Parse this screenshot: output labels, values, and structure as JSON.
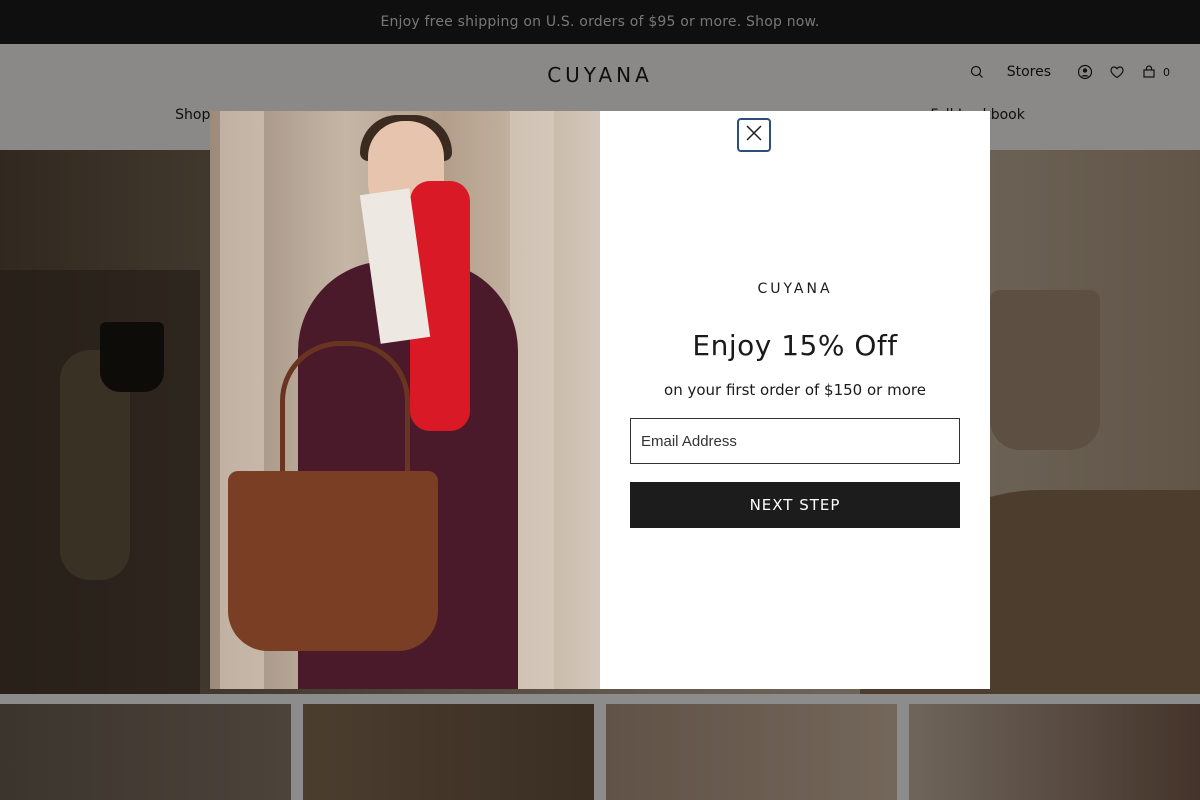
{
  "promo_bar": {
    "text": "Enjoy free shipping on U.S. orders of $95 or more. Shop now."
  },
  "header": {
    "logo": "CUYANA",
    "stores_label": "Stores",
    "cart_count": "0",
    "nav": [
      "Shop",
      "",
      "",
      "",
      "",
      "",
      "Fall Lookbook"
    ]
  },
  "modal": {
    "logo": "CUYANA",
    "title": "Enjoy 15% Off",
    "subtitle": "on your first order of $150 or more",
    "email_placeholder": "Email Address",
    "button_label": "NEXT STEP"
  }
}
